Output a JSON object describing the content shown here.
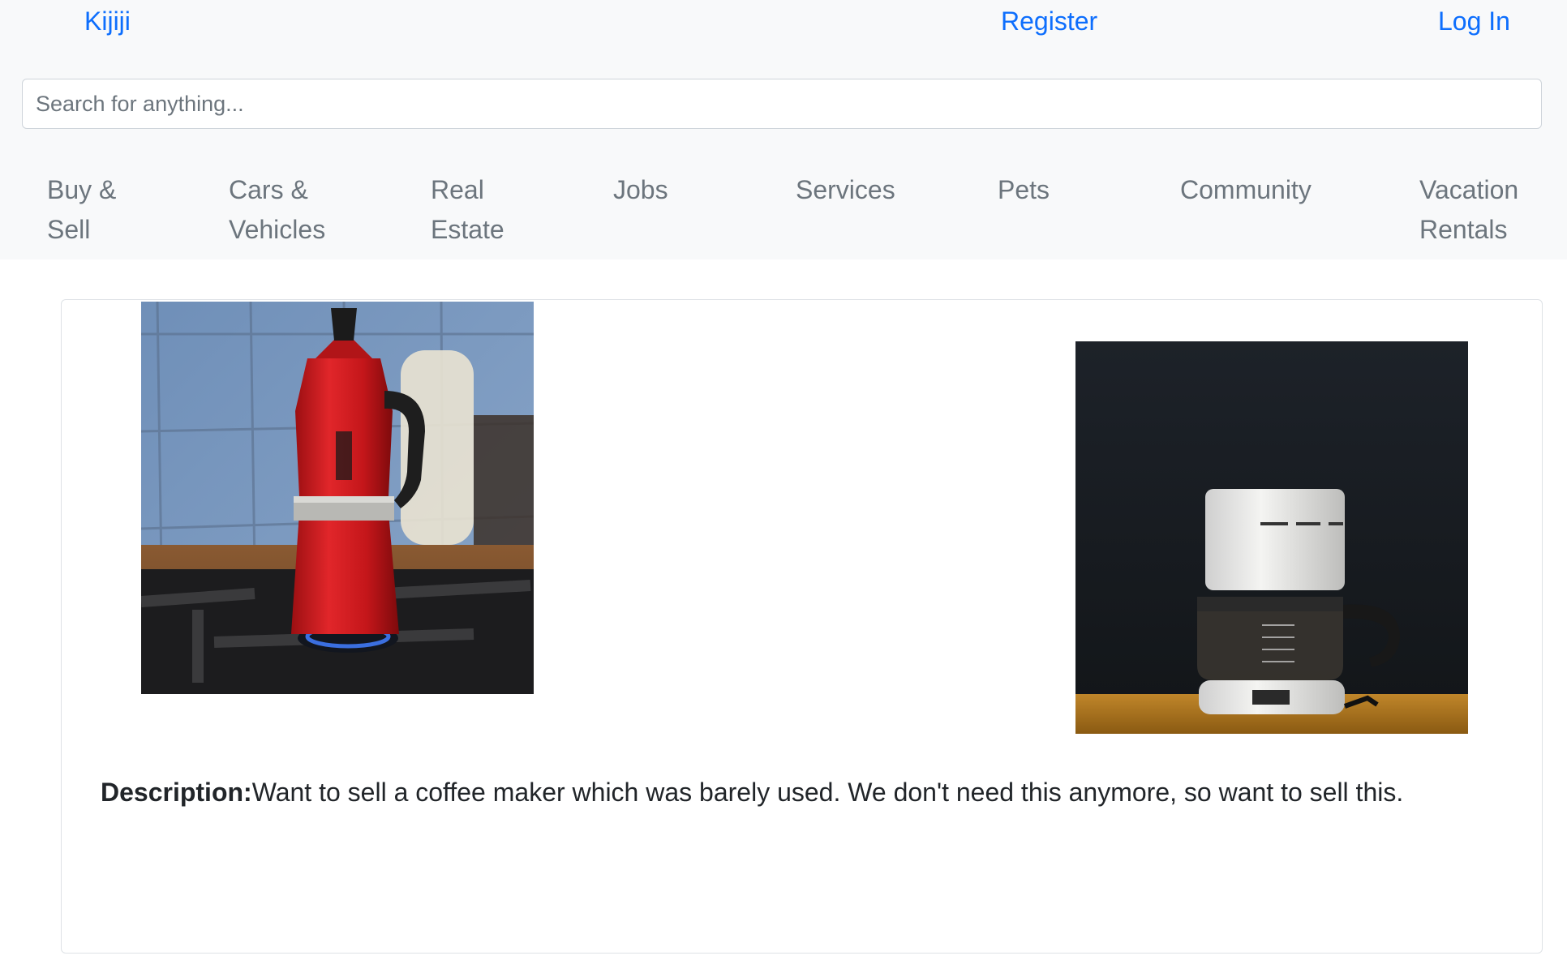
{
  "header": {
    "brand": "Kijiji",
    "register": "Register",
    "login": "Log In"
  },
  "search": {
    "placeholder": "Search for anything..."
  },
  "categories": [
    {
      "line1": "Buy &",
      "line2": "Sell"
    },
    {
      "line1": "Cars &",
      "line2": "Vehicles"
    },
    {
      "line1": "Real",
      "line2": "Estate"
    },
    {
      "line1": "Jobs",
      "line2": ""
    },
    {
      "line1": "Services",
      "line2": ""
    },
    {
      "line1": "Pets",
      "line2": ""
    },
    {
      "line1": "Community",
      "line2": ""
    },
    {
      "line1": "Vacation",
      "line2": "Rentals"
    }
  ],
  "listing": {
    "description_label": "Description:",
    "description_text": "Want to sell a coffee maker which was barely used. We don't need this anymore, so want to sell this."
  },
  "colors": {
    "link": "#0d6efd",
    "header_bg": "#f8f9fa",
    "muted_text": "#6c757d"
  }
}
